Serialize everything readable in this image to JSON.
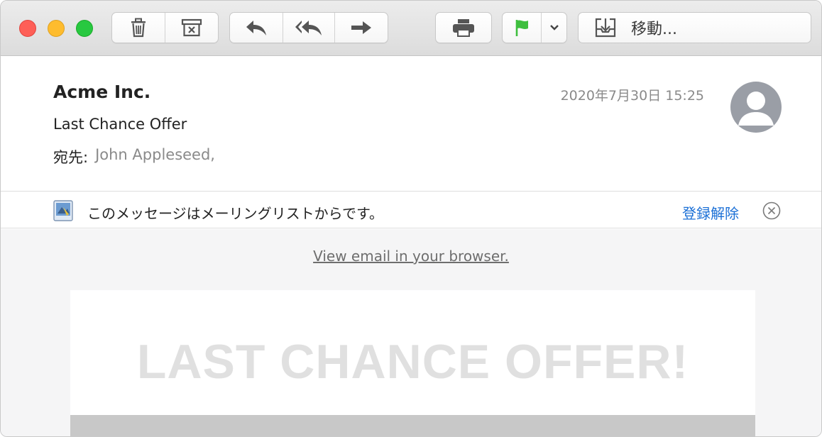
{
  "toolbar": {
    "move_label": "移動...",
    "flag_color": "#3fbf3f"
  },
  "message": {
    "sender": "Acme Inc.",
    "subject": "Last Chance Offer",
    "to_label": "宛先:",
    "to_value": "John Appleseed,",
    "date": "2020年7月30日 15:25"
  },
  "banner": {
    "text": "このメッセージはメーリングリストからです。",
    "unsubscribe": "登録解除"
  },
  "content": {
    "browser_link": "View email in your browser.",
    "headline": "LAST CHANCE OFFER!"
  },
  "colors": {
    "link": "#1a6fd6",
    "close": "#fe5f57",
    "minimize": "#febc2e",
    "maximize": "#28c840"
  }
}
